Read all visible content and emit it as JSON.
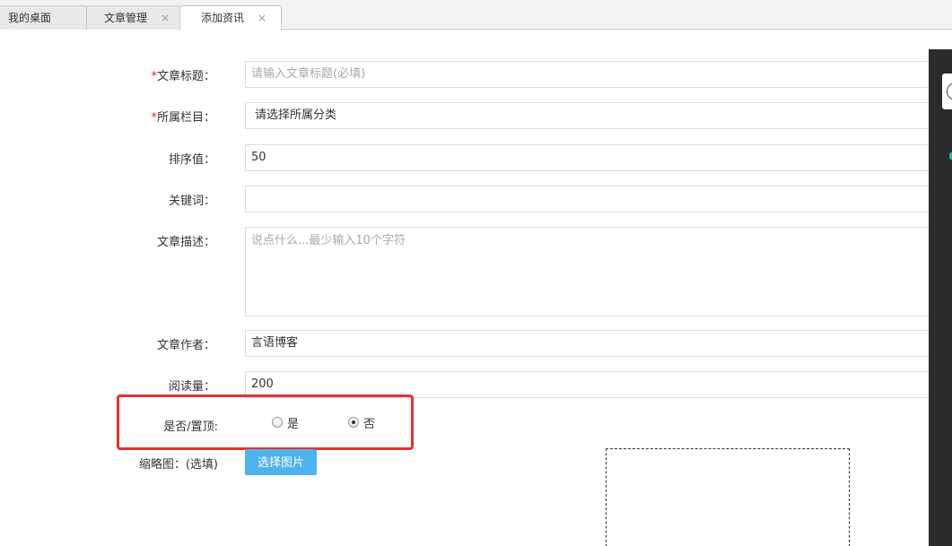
{
  "tabs": [
    {
      "label": "我的桌面",
      "closable": false
    },
    {
      "label": "文章管理",
      "closable": true
    },
    {
      "label": "添加资讯",
      "closable": true,
      "active": true
    }
  ],
  "close_glyph": "×",
  "required_mark": "*",
  "form": {
    "title": {
      "label": "文章标题：",
      "placeholder": "请输入文章标题(必填)",
      "required": true
    },
    "category": {
      "label": "所属栏目：",
      "value": "请选择所属分类",
      "required": true
    },
    "sort": {
      "label": "排序值：",
      "value": "50"
    },
    "keywords": {
      "label": "关键词：",
      "value": ""
    },
    "description": {
      "label": "文章描述：",
      "placeholder": "说点什么...最少输入10个字符"
    },
    "author": {
      "label": "文章作者：",
      "value": "言语博客"
    },
    "views": {
      "label": "阅读量：",
      "value": "200"
    },
    "top": {
      "label": "是否/置顶:",
      "options": [
        {
          "label": "是",
          "checked": false
        },
        {
          "label": "否",
          "checked": true
        }
      ]
    },
    "thumbnail": {
      "label": "缩略图：(选填)",
      "button_label": "选择图片"
    }
  },
  "colors": {
    "accent_button": "#4db2ee",
    "required": "#e02a2a",
    "highlight": "#e63030"
  }
}
